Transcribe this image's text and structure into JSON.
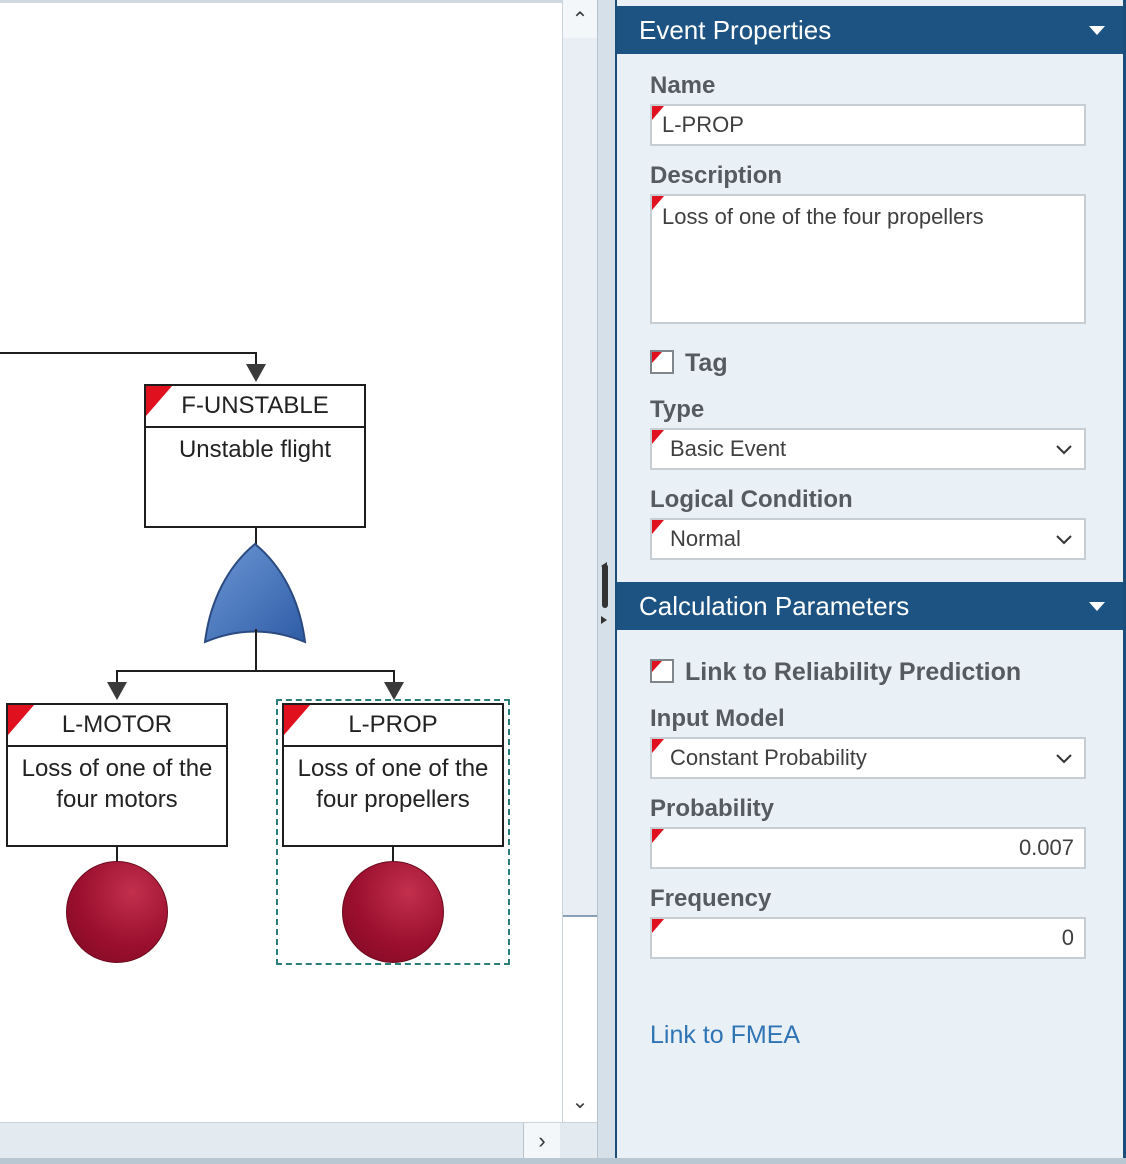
{
  "diagram": {
    "nodes": [
      {
        "id": "F-UNSTABLE",
        "description": "Unstable flight"
      },
      {
        "id": "L-MOTOR",
        "description": "Loss of one of the four motors"
      },
      {
        "id": "L-PROP",
        "description": "Loss of one of the four propellers"
      }
    ],
    "selected_node": "L-PROP"
  },
  "scroll": {
    "up_icon": "⌃",
    "down_icon": "⌄",
    "right_icon": "›"
  },
  "panel": {
    "event_properties": {
      "title": "Event Properties",
      "name_label": "Name",
      "name_value": "L-PROP",
      "description_label": "Description",
      "description_value": "Loss of one of the four propellers",
      "tag_label": "Tag",
      "tag_checked": false,
      "type_label": "Type",
      "type_value": "Basic Event",
      "logical_condition_label": "Logical Condition",
      "logical_condition_value": "Normal"
    },
    "calculation_parameters": {
      "title": "Calculation Parameters",
      "link_reliability_label": "Link to Reliability Prediction",
      "link_reliability_checked": false,
      "input_model_label": "Input Model",
      "input_model_value": "Constant Probability",
      "probability_label": "Probability",
      "probability_value": "0.007",
      "frequency_label": "Frequency",
      "frequency_value": "0",
      "link_fmea": "Link to FMEA"
    },
    "chevron_icon": "⌵"
  }
}
